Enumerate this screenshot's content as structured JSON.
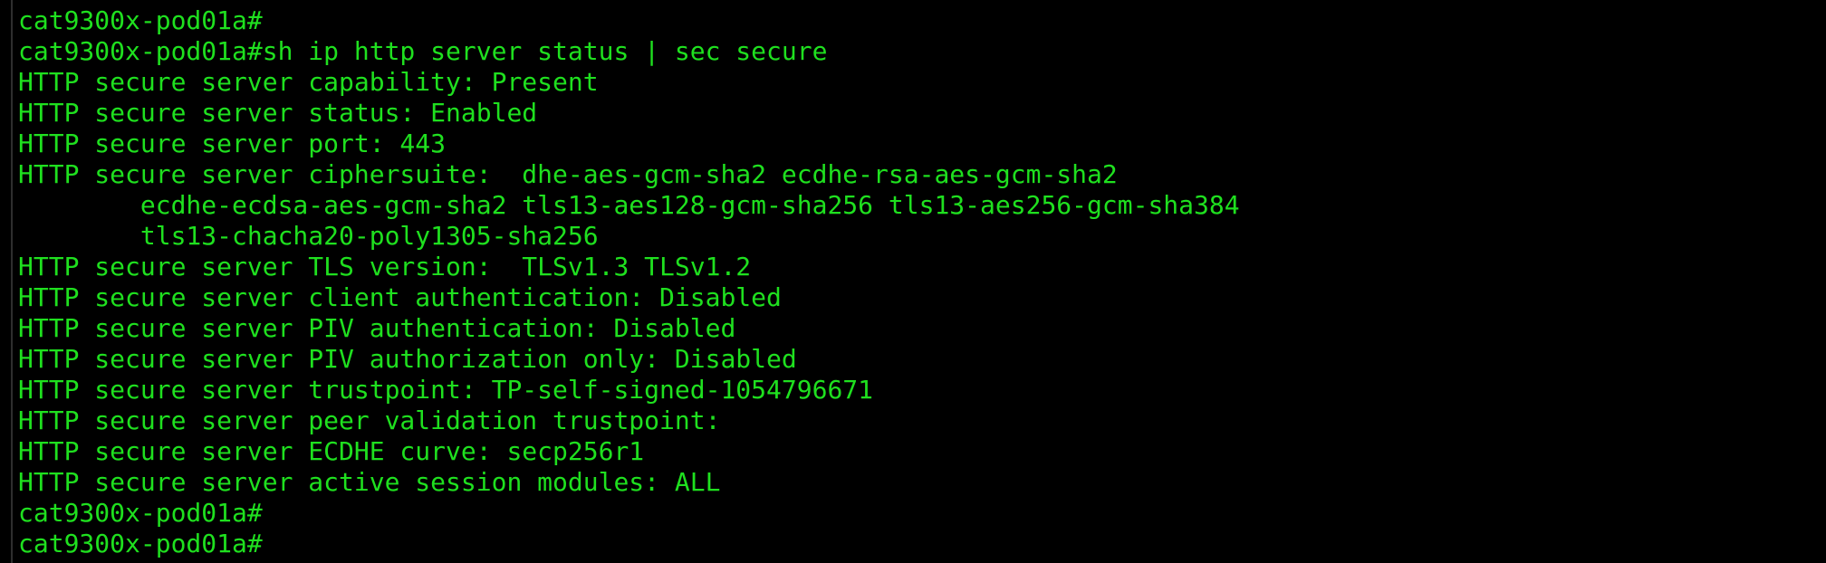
{
  "terminal": {
    "lines": [
      "cat9300x-pod01a#",
      "cat9300x-pod01a#sh ip http server status | sec secure",
      "HTTP secure server capability: Present",
      "HTTP secure server status: Enabled",
      "HTTP secure server port: 443",
      "HTTP secure server ciphersuite:  dhe-aes-gcm-sha2 ecdhe-rsa-aes-gcm-sha2",
      "        ecdhe-ecdsa-aes-gcm-sha2 tls13-aes128-gcm-sha256 tls13-aes256-gcm-sha384",
      "        tls13-chacha20-poly1305-sha256",
      "HTTP secure server TLS version:  TLSv1.3 TLSv1.2",
      "HTTP secure server client authentication: Disabled",
      "HTTP secure server PIV authentication: Disabled",
      "HTTP secure server PIV authorization only: Disabled",
      "HTTP secure server trustpoint: TP-self-signed-1054796671",
      "HTTP secure server peer validation trustpoint:",
      "HTTP secure server ECDHE curve: secp256r1",
      "HTTP secure server active session modules: ALL",
      "cat9300x-pod01a#",
      "cat9300x-pod01a#"
    ],
    "colors": {
      "background": "#000000",
      "text": "#1fe01f"
    }
  }
}
